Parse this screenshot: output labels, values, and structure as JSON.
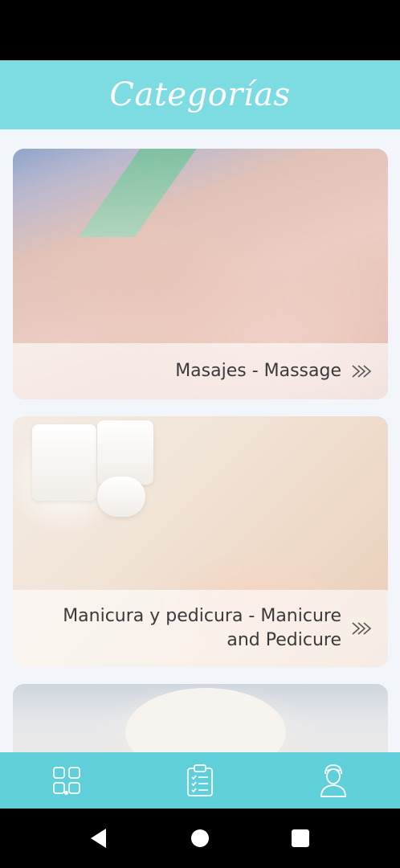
{
  "header": {
    "title": "Categorías"
  },
  "categories": [
    {
      "label": "Masajes - Massage",
      "icon": "double-chevron-right-icon"
    },
    {
      "label": "Manicura y pedicura - Manicure and Pedicure",
      "icon": "double-chevron-right-icon"
    },
    {
      "label": "",
      "icon": "double-chevron-right-icon"
    }
  ],
  "bottom_nav": {
    "items": [
      {
        "name": "categories",
        "icon": "grid-icon",
        "active": true
      },
      {
        "name": "appointments",
        "icon": "clipboard-list-icon",
        "active": false
      },
      {
        "name": "profile",
        "icon": "user-icon",
        "active": false
      }
    ]
  },
  "colors": {
    "header": "#7ddbe2",
    "bottom_nav": "#5fcfd9",
    "background": "#f2f5f9"
  }
}
